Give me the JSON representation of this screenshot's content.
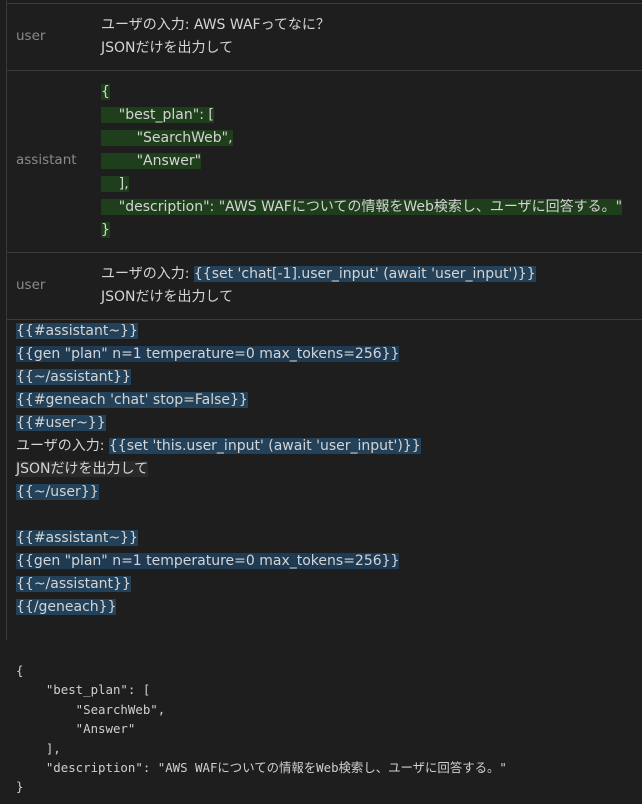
{
  "chat": {
    "messages": [
      {
        "role": "user",
        "lines": [
          "ユーザの入力: AWS WAFってなに？",
          "JSONだけを出力して"
        ]
      },
      {
        "role": "assistant",
        "lines": [
          "{",
          "    \"best_plan\": [",
          "        \"SearchWeb\",",
          "        \"Answer\"",
          "    ],",
          "    \"description\": \"AWS WAFについての情報をWeb検索し、ユーザに回答する。\"",
          "}"
        ]
      },
      {
        "role": "user",
        "line1_prefix": "ユーザの入力: ",
        "line1_highlight": "{{set 'chat[-1].user_input' (await 'user_input')}}",
        "line2": "JSONだけを出力して"
      }
    ]
  },
  "template": {
    "lines": [
      "{{#assistant~}}",
      "{{gen \"plan\" n=1 temperature=0 max_tokens=256}}",
      "{{~/assistant}}",
      "{{#geneach 'chat' stop=False}}",
      "{{#user~}}",
      "{{set 'this.user_input' (await 'user_input')}}",
      "JSONだけを出力して",
      "{{~/user}}",
      "",
      "{{#assistant~}}",
      "{{gen \"plan\" n=1 temperature=0 max_tokens=256}}",
      "{{~/assistant}}",
      "{{/geneach}}"
    ],
    "user_input_prefix": "ユーザの入力: "
  },
  "output": {
    "lines": [
      "{",
      "    \"best_plan\": [",
      "        \"SearchWeb\",",
      "        \"Answer\"",
      "    ],",
      "    \"description\": \"AWS WAFについての情報をWeb検索し、ユーザに回答する。\"",
      "}"
    ]
  }
}
